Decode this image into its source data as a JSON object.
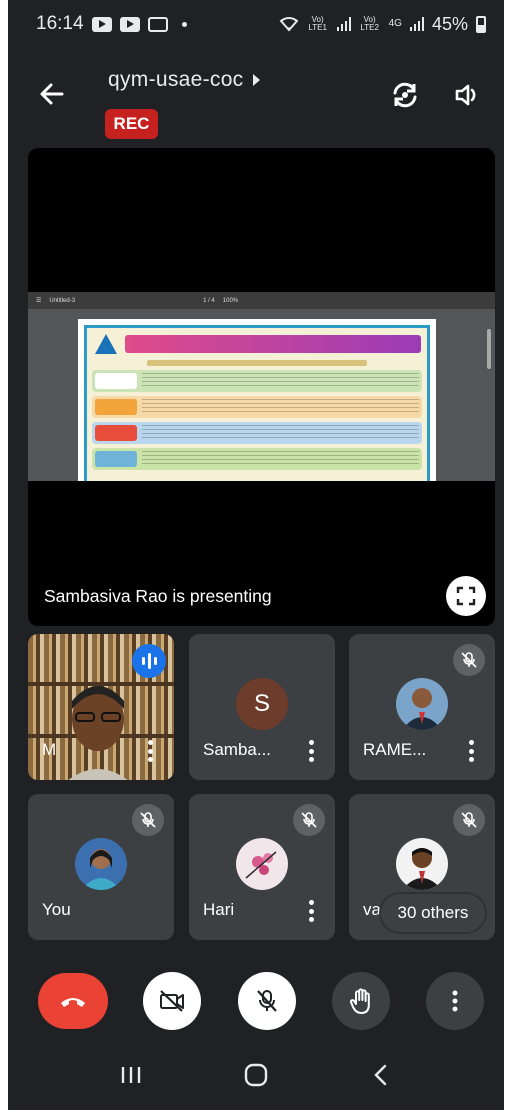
{
  "status_bar": {
    "time": "16:14",
    "network_1": "Vo) LTE1",
    "network_2": "Vo) LTE2",
    "network_type": "4G",
    "battery": "45%"
  },
  "header": {
    "meeting_code": "qym-usae-coc",
    "rec_badge": "REC"
  },
  "presentation": {
    "presenting_text": "Sambasiva Rao is presenting",
    "doc_toolbar": {
      "file_name": "Untitled-3",
      "page_indicator": "1 / 4",
      "zoom": "100%"
    }
  },
  "participants": [
    {
      "name": "M",
      "avatar_letter": "",
      "muted": false,
      "speaking": true,
      "video": true
    },
    {
      "name": "Samba...",
      "avatar_letter": "S",
      "muted": false,
      "speaking": false,
      "video": false
    },
    {
      "name": "RAME...",
      "avatar_letter": "",
      "muted": true,
      "speaking": false,
      "video": false
    },
    {
      "name": "You",
      "avatar_letter": "",
      "muted": true,
      "speaking": false,
      "video": false
    },
    {
      "name": "Hari",
      "avatar_letter": "",
      "muted": true,
      "speaking": false,
      "video": false
    },
    {
      "name": "vad",
      "avatar_letter": "",
      "muted": true,
      "speaking": false,
      "video": false
    }
  ],
  "others_count": "30 others",
  "controls": [
    "end-call",
    "camera-off",
    "mic-off",
    "raise-hand",
    "more-options"
  ],
  "colors": {
    "background": "#202124",
    "tile": "#3c4043",
    "end_call": "#ea4335",
    "rec": "#c5221f",
    "speaking": "#1a73e8"
  }
}
